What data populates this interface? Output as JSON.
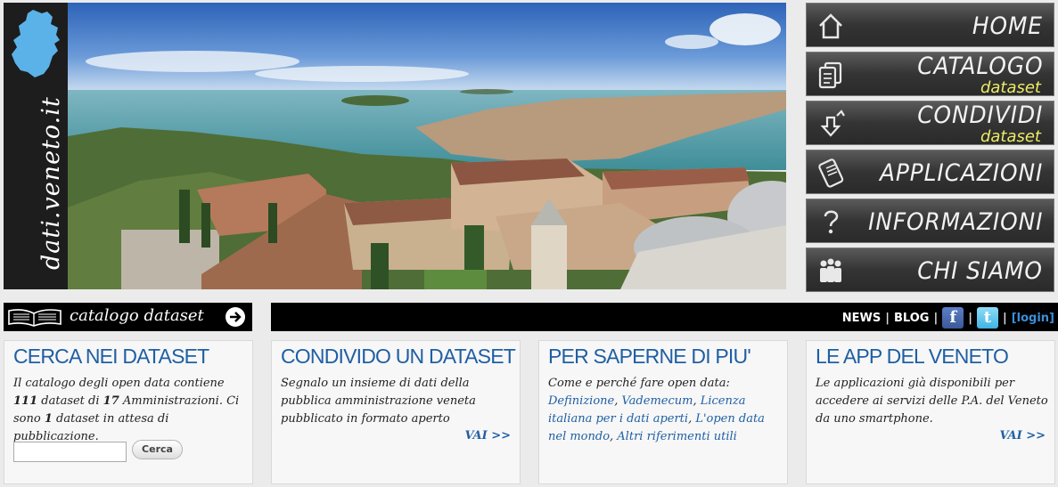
{
  "logo": {
    "text": "dati.veneto.it"
  },
  "nav": [
    {
      "label": "HOME",
      "icon": "house-icon"
    },
    {
      "label": "CATALOGO",
      "sub": "dataset",
      "icon": "documents-icon"
    },
    {
      "label": "CONDIVIDI",
      "sub": "dataset",
      "icon": "share-icon"
    },
    {
      "label": "APPLICAZIONI",
      "icon": "mobile-phone-icon"
    },
    {
      "label": "INFORMAZIONI",
      "icon": "question-icon"
    },
    {
      "label": "CHI SIAMO",
      "icon": "people-icon"
    }
  ],
  "catalog_bar": {
    "label": "catalogo dataset"
  },
  "top_links": {
    "news": "NEWS",
    "blog": "BLOG",
    "sep": "|",
    "facebook": "f",
    "twitter": "t",
    "login": "[login]"
  },
  "cards": {
    "search": {
      "title": "CERCA NEI DATASET",
      "t1": "Il catalogo degli open data contiene ",
      "count_datasets": "111",
      "t2": " dataset di ",
      "count_admins": "17",
      "t3": " Amministrazioni. Ci sono ",
      "count_pending": "1",
      "t4": " dataset in attesa di pubblicazione.",
      "search_value": "",
      "search_button": "Cerca"
    },
    "share": {
      "title": "CONDIVIDO UN DATASET",
      "text": "Segnalo un insieme di dati della pubblica amministrazione veneta pubblicato in formato aperto",
      "vai": "VAI >>"
    },
    "info": {
      "title": "PER SAPERNE DI PIU'",
      "intro": "Come e perché fare open data:",
      "links": [
        "Definizione",
        "Vademecum",
        "Licenza italiana per i dati aperti",
        "L'open data nel mondo",
        "Altri riferimenti utili"
      ],
      "link_sep": ", "
    },
    "apps": {
      "title": "LE APP DEL VENETO",
      "text": "Le applicazioni già disponibili per accedere ai servizi delle P.A. del Veneto da uno smartphone.",
      "vai": "VAI >>"
    }
  },
  "colors": {
    "accent": "#1f5fa3",
    "nav_sub": "#ecec66",
    "login": "#3a8fd8"
  }
}
